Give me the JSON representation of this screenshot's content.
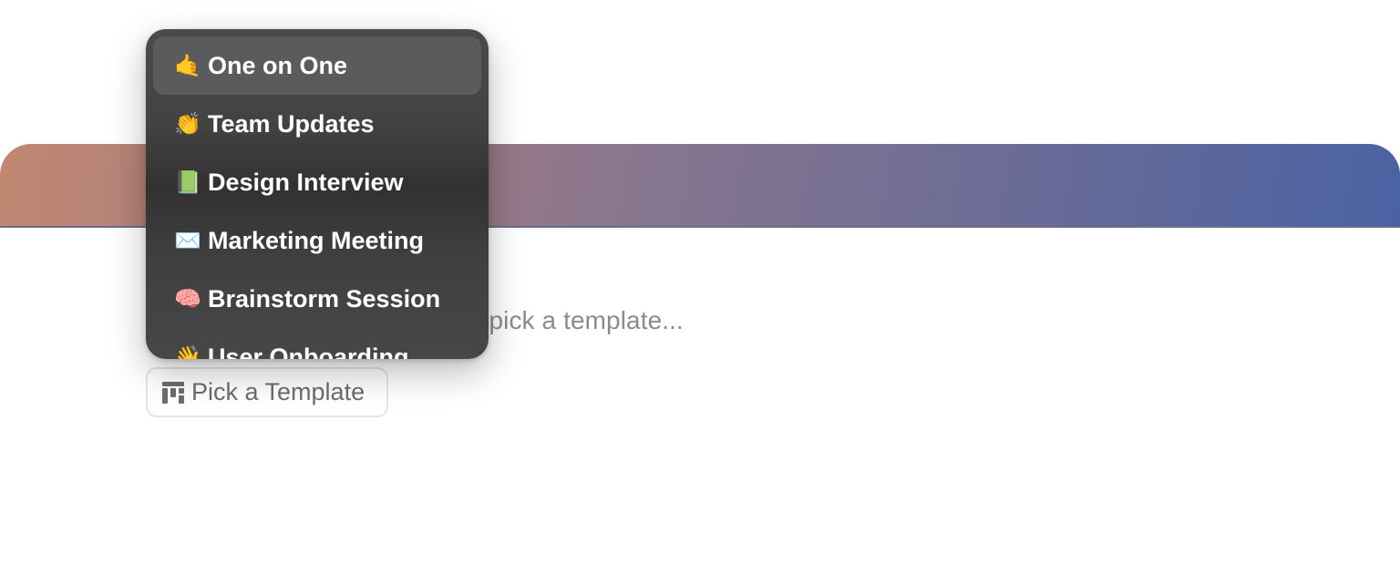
{
  "editor": {
    "placeholder": "Start writing notes, tasks or pick a template..."
  },
  "template_button": {
    "label": "Pick a Template",
    "icon": "template-grid-icon"
  },
  "template_menu": {
    "items": [
      {
        "emoji": "🤙",
        "label": "One on One",
        "active": true
      },
      {
        "emoji": "👏",
        "label": "Team Updates",
        "active": false
      },
      {
        "emoji": "📗",
        "label": "Design Interview",
        "active": false
      },
      {
        "emoji": "✉️",
        "label": "Marketing Meeting",
        "active": false
      },
      {
        "emoji": "🧠",
        "label": "Brainstorm Session",
        "active": false
      },
      {
        "emoji": "👋",
        "label": "User Onboarding",
        "active": false
      }
    ]
  },
  "colors": {
    "banner_start": "#c18872",
    "banner_end": "#4a62a3",
    "menu_bg": "#454545",
    "menu_active": "#5a5b5c"
  }
}
